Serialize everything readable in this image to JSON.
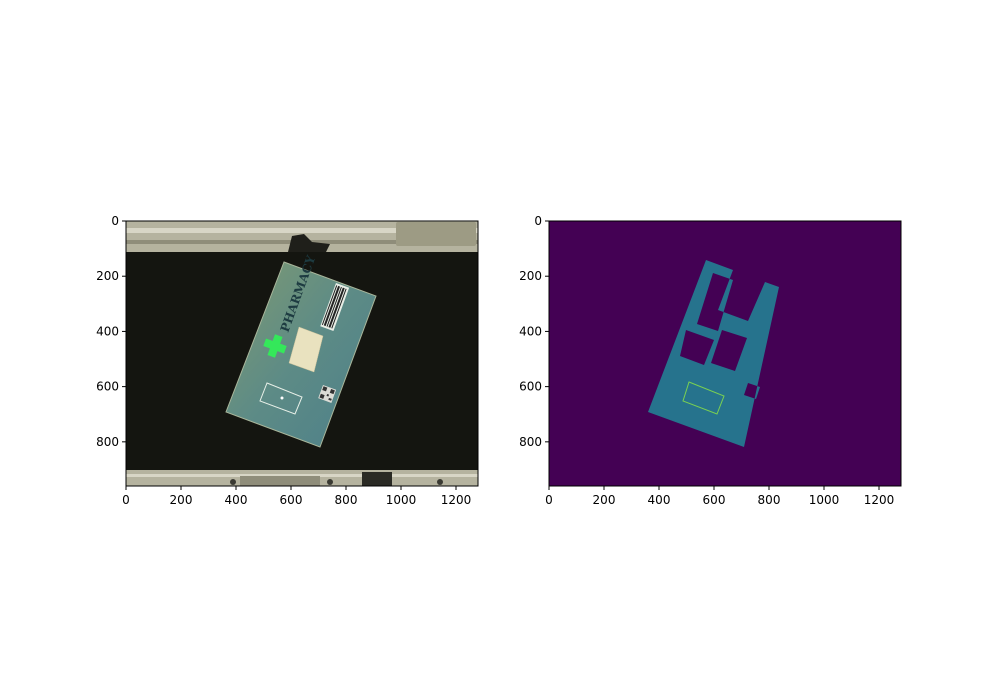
{
  "chart_data": [
    {
      "type": "image",
      "x_ticks": [
        0,
        200,
        400,
        600,
        800,
        1000,
        1200
      ],
      "y_ticks": [
        0,
        200,
        400,
        600,
        800
      ],
      "xlim": [
        0,
        1280
      ],
      "ylim": [
        960,
        0
      ],
      "image_text": {
        "pharmacy_label": "PHARMACY"
      }
    },
    {
      "type": "image",
      "x_ticks": [
        0,
        200,
        400,
        600,
        800,
        1000,
        1200
      ],
      "y_ticks": [
        0,
        200,
        400,
        600,
        800
      ],
      "xlim": [
        0,
        1280
      ],
      "ylim": [
        960,
        0
      ],
      "colors": {
        "background": "#440154",
        "mask": "#26738d",
        "outline": "#7ad151"
      }
    }
  ]
}
